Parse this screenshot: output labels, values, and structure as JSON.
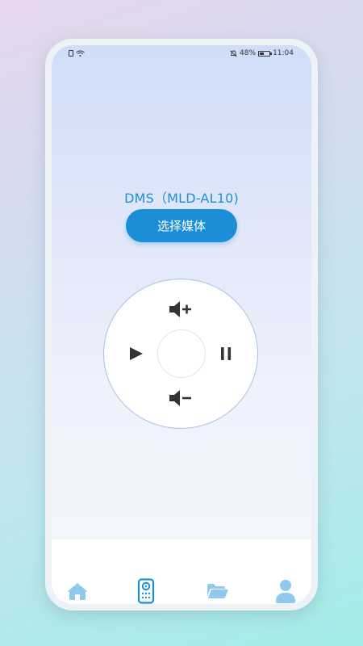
{
  "status_bar": {
    "battery_text": "48%",
    "battery_level": 0.48,
    "time": "11:04"
  },
  "device": {
    "name": "DMS（MLD-AL10)"
  },
  "actions": {
    "select_media_label": "选择媒体"
  },
  "remote": {
    "buttons": [
      "volume-up",
      "play",
      "ok",
      "pause",
      "volume-down"
    ]
  },
  "tab_bar": {
    "tabs": [
      {
        "icon": "home-icon",
        "active": false
      },
      {
        "icon": "remote-control-icon",
        "active": true
      },
      {
        "icon": "folder-icon",
        "active": false
      },
      {
        "icon": "user-icon",
        "active": false
      }
    ]
  },
  "colors": {
    "accent": "#1c8ed8",
    "tab_icon": "#8fc9ee",
    "control_icon": "#333333"
  }
}
